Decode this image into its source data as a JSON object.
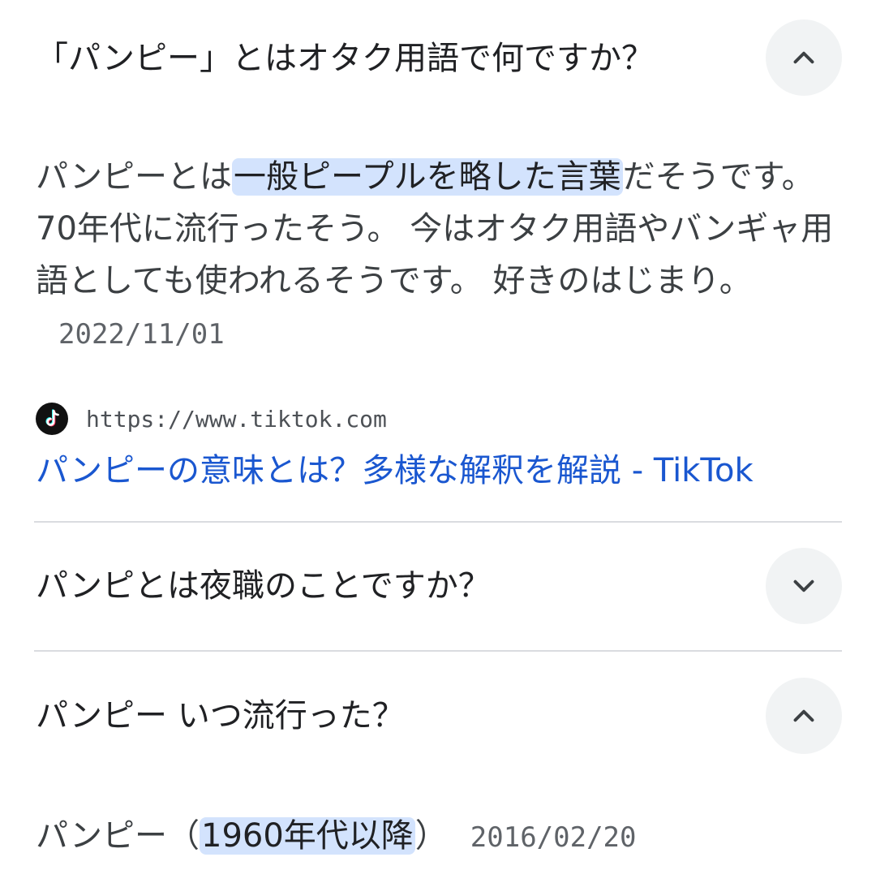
{
  "faq": [
    {
      "question": "「パンピー」とはオタク用語で何ですか？",
      "expanded": true,
      "toggle_icon": "chevron-up-icon",
      "answer": {
        "text_before": "パンピーとは",
        "highlight": "一般ピープルを略した言葉",
        "text_after": "だそうです。 70年代に流行ったそう。 今はオタク用語やバンギャ用語としても使われるそうです。 好きのはじまり。",
        "date": "2022/11/01"
      },
      "source": {
        "favicon": "tiktok-icon",
        "url": "https://www.tiktok.com",
        "title": "パンピーの意味とは？多様な解釈を解説 - TikTok"
      }
    },
    {
      "question": "パンピとは夜職のことですか？",
      "expanded": false,
      "toggle_icon": "chevron-down-icon"
    },
    {
      "question": "パンピー いつ流行った？",
      "expanded": true,
      "toggle_icon": "chevron-up-icon",
      "answer": {
        "text_before": "パンピー（",
        "highlight": "1960年代以降",
        "text_after": "）",
        "date": "2016/02/20"
      }
    }
  ],
  "colors": {
    "link": "#1a57d0",
    "highlight": "#d3e3fd",
    "toggle_bg": "#f1f3f4",
    "divider": "#dadce0"
  }
}
